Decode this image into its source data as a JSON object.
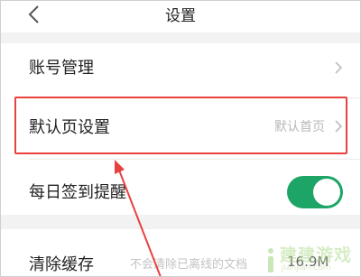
{
  "header": {
    "title": "设置",
    "back_icon": "chevron-left-icon"
  },
  "settings": {
    "items": [
      {
        "label": "账号管理",
        "value": ""
      },
      {
        "label": "默认页设置",
        "value": "默认首页"
      },
      {
        "label": "每日签到提醒",
        "toggle_on": true
      }
    ]
  },
  "cache": {
    "label": "清除缓存",
    "note": "不会清除已离线的文档",
    "size": "16.9M"
  },
  "watermark": {
    "text": "建建游戏",
    "url": "jianjian.com"
  },
  "colors": {
    "accent": "#1ca566",
    "highlight": "#e8413f"
  }
}
